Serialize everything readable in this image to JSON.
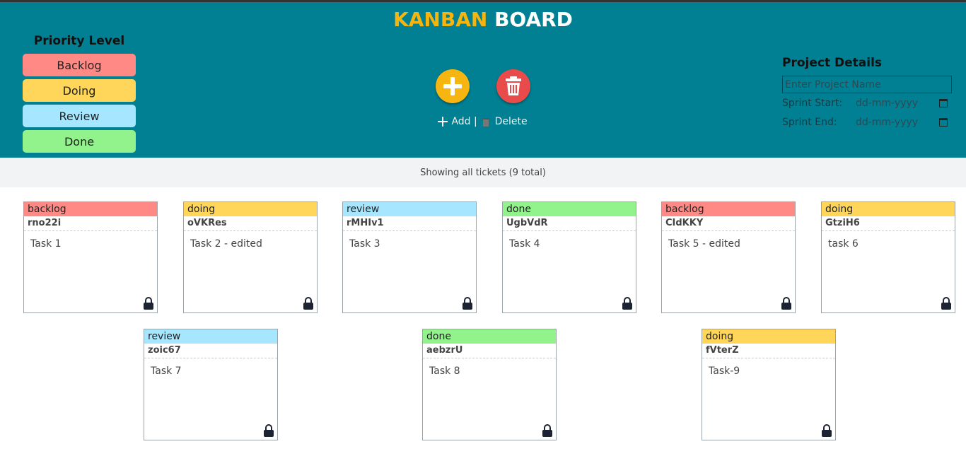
{
  "header": {
    "title_part1": "KANBAN",
    "title_part2": "BOARD"
  },
  "priority": {
    "heading": "Priority Level",
    "levels": [
      {
        "label": "Backlog",
        "color": "#ff8a85"
      },
      {
        "label": "Doing",
        "color": "#ffd659"
      },
      {
        "label": "Review",
        "color": "#a6e7ff"
      },
      {
        "label": "Done",
        "color": "#92f28b"
      }
    ]
  },
  "actions": {
    "add_label": "Add",
    "separator": "|",
    "delete_label": "Delete"
  },
  "project": {
    "heading": "Project Details",
    "name_placeholder": "Enter Project Name",
    "sprint_start_label": "Sprint Start:",
    "sprint_start_value": "dd-mm-yyyy",
    "sprint_end_label": "Sprint End:",
    "sprint_end_value": "dd-mm-yyyy"
  },
  "status": {
    "text": "Showing all tickets (9 total)"
  },
  "tickets": [
    {
      "priority": "backlog",
      "id": "rno22i",
      "desc": "Task 1",
      "color": "#ff8a85"
    },
    {
      "priority": "doing",
      "id": "oVKRes",
      "desc": "Task 2 - edited",
      "color": "#ffd659"
    },
    {
      "priority": "review",
      "id": "rMHIv1",
      "desc": "Task 3",
      "color": "#a6e7ff"
    },
    {
      "priority": "done",
      "id": "UgbVdR",
      "desc": "Task 4",
      "color": "#92f28b"
    },
    {
      "priority": "backlog",
      "id": "CIdKKY",
      "desc": "Task 5 - edited",
      "color": "#ff8a85"
    },
    {
      "priority": "doing",
      "id": "GtziH6",
      "desc": "task 6",
      "color": "#ffd659"
    },
    {
      "priority": "review",
      "id": "zoic67",
      "desc": "Task 7",
      "color": "#a6e7ff"
    },
    {
      "priority": "done",
      "id": "aebzrU",
      "desc": "Task 8",
      "color": "#92f28b"
    },
    {
      "priority": "doing",
      "id": "fVterZ",
      "desc": "Task-9",
      "color": "#ffd659"
    }
  ]
}
